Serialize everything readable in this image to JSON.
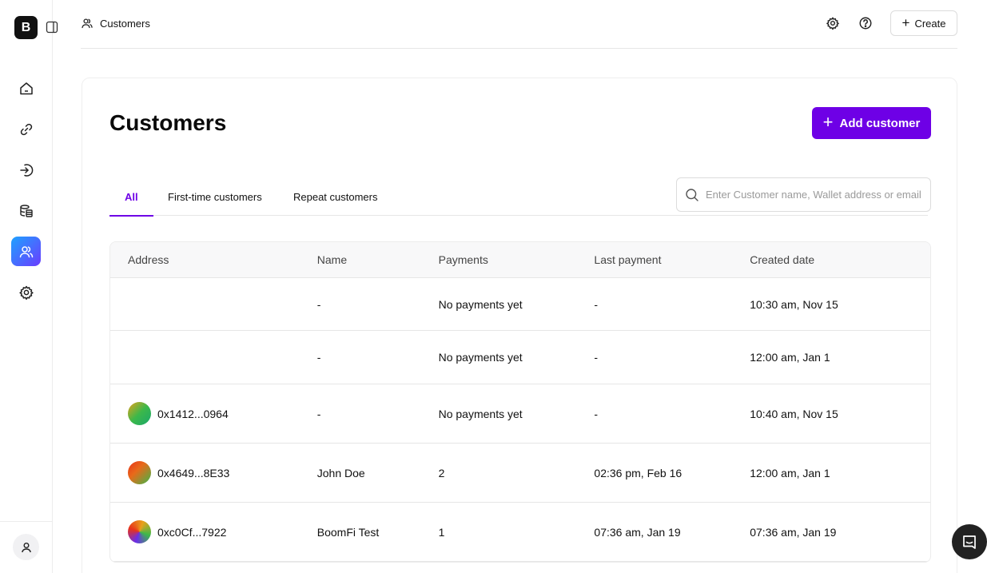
{
  "sidebar": {
    "logo_letter": "B",
    "nav": [
      {
        "name": "home",
        "icon": "home-icon"
      },
      {
        "name": "payment-links",
        "icon": "link-icon"
      },
      {
        "name": "payments-in",
        "icon": "arrow-in-icon"
      },
      {
        "name": "database",
        "icon": "database-icon"
      },
      {
        "name": "customers",
        "icon": "users-icon",
        "active": true
      },
      {
        "name": "settings",
        "icon": "gear-icon"
      }
    ]
  },
  "header": {
    "breadcrumb": "Customers",
    "create_label": "Create"
  },
  "page": {
    "title": "Customers",
    "add_button_label": "Add customer",
    "accent_color": "#6e00e6"
  },
  "tabs": [
    {
      "label": "All",
      "active": true
    },
    {
      "label": "First-time customers",
      "active": false
    },
    {
      "label": "Repeat customers",
      "active": false
    }
  ],
  "search": {
    "placeholder": "Enter Customer name, Wallet address or email"
  },
  "table": {
    "columns": [
      "Address",
      "Name",
      "Payments",
      "Last payment",
      "Created date"
    ],
    "rows": [
      {
        "address": "",
        "name": "-",
        "payments": "No payments yet",
        "last_payment": "-",
        "created": "10:30 am, Nov 15"
      },
      {
        "address": "",
        "name": "-",
        "payments": "No payments yet",
        "last_payment": "-",
        "created": "12:00 am, Jan 1"
      },
      {
        "address": "0x1412...0964",
        "name": "-",
        "payments": "No payments yet",
        "last_payment": "-",
        "created": "10:40 am, Nov 15"
      },
      {
        "address": "0x4649...8E33",
        "name": "John Doe",
        "payments": "2",
        "last_payment": "02:36 pm, Feb 16",
        "created": "12:00 am, Jan 1"
      },
      {
        "address": "0xc0Cf...7922",
        "name": "BoomFi Test",
        "payments": "1",
        "last_payment": "07:36 am, Jan 19",
        "created": "07:36 am, Jan 19"
      }
    ]
  }
}
